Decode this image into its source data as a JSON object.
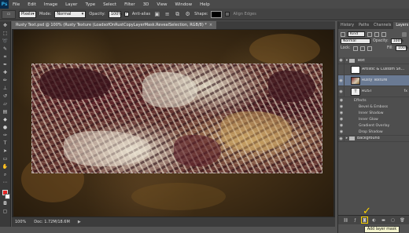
{
  "app": {
    "logo": "Ps"
  },
  "menu": [
    "File",
    "Edit",
    "Image",
    "Layer",
    "Type",
    "Select",
    "Filter",
    "3D",
    "View",
    "Window",
    "Help"
  ],
  "options": {
    "tool_icon": "rectangular-marquee-icon",
    "preset_value": "Pixels",
    "mode_label": "Mode:",
    "mode_value": "Normal",
    "opacity_label": "Opacity:",
    "opacity_value": "100%",
    "antialias_label": "Anti-alias",
    "antialias_checked": "✓",
    "shape_label": "Shape:",
    "align_edges_label": "Align Edges"
  },
  "document": {
    "tab_title": "Rusty Text.psd @ 100% (Rusty Texture (LoadsofOnRustCopyLayerMask.RevealSelection, RGB/8) *",
    "close": "×"
  },
  "status": {
    "zoom": "100%",
    "doc_info": "Doc: 1.72M/18.6M",
    "arrow": "▶"
  },
  "panels": {
    "tabs": [
      "History",
      "Paths",
      "Channels",
      "Layers"
    ],
    "active_tab": "Layers",
    "filter_value": "Kind",
    "blend_value": "Normal",
    "opacity_label": "Opacity:",
    "opacity_value": "100%",
    "lock_label": "Lock:",
    "fill_label": "Fill:",
    "fill_value": "100%"
  },
  "layers": [
    {
      "name": "Text",
      "type": "group"
    },
    {
      "name": "Artistic & Custom Sh...",
      "type": "layer"
    },
    {
      "name": "Rusty Texture",
      "type": "layer",
      "selected": true
    },
    {
      "name": "RUST",
      "type": "text",
      "fx": "fx"
    },
    {
      "name": "Effects",
      "type": "effect-header"
    },
    {
      "name": "Bevel & Emboss",
      "type": "effect"
    },
    {
      "name": "Inner Shadow",
      "type": "effect"
    },
    {
      "name": "Inner Glow",
      "type": "effect"
    },
    {
      "name": "Gradient Overlay",
      "type": "effect"
    },
    {
      "name": "Drop Shadow",
      "type": "effect"
    },
    {
      "name": "Background",
      "type": "group"
    }
  ],
  "tooltip": {
    "text": "Add layer mask",
    "checkmark": "✓"
  },
  "colors": {
    "foreground": "#e62525",
    "background": "#ffffff",
    "selection": "#6a7a93",
    "highlight": "#ffd400"
  }
}
